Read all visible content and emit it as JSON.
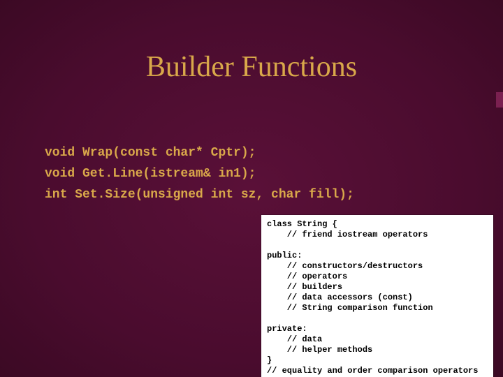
{
  "slide": {
    "title": "Builder Functions",
    "code_lines": [
      "void Wrap(const char* Cptr);",
      "void Get.Line(istream& in1);",
      "int Set.Size(unsigned int sz, char fill);"
    ],
    "class_box_text": "class String {\n    // friend iostream operators\n\npublic:\n    // constructors/destructors\n    // operators\n    // builders\n    // data accessors (const)\n    // String comparison function\n\nprivate:\n    // data\n    // helper methods\n}\n// equality and order comparison operators"
  }
}
